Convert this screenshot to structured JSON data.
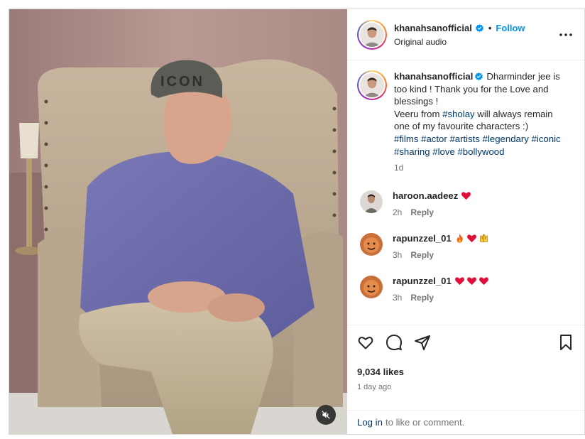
{
  "header": {
    "username": "khanahsanofficial",
    "separator": "•",
    "follow_label": "Follow",
    "audio": "Original audio"
  },
  "caption": {
    "username": "khanahsanofficial",
    "line1": "Dharminder jee is too kind ! Thank you for the Love and blessings !",
    "line2_prefix": "Veeru from ",
    "line2_tag": "#sholay",
    "line2_suffix": " will always remain one of my favourite characters :)",
    "tags": [
      "#films",
      "#actor",
      "#artists",
      "#legendary",
      "#iconic",
      "#sharing",
      "#love",
      "#bollywood"
    ],
    "time": "1d"
  },
  "comments": [
    {
      "username": "haroon.aadeez",
      "emojis": [
        "red-heart"
      ],
      "time": "2h",
      "reply_label": "Reply"
    },
    {
      "username": "rapunzzel_01",
      "emojis": [
        "fire",
        "red-heart",
        "raising-hands"
      ],
      "time": "3h",
      "reply_label": "Reply"
    },
    {
      "username": "rapunzzel_01",
      "emojis": [
        "red-heart",
        "red-heart",
        "red-heart"
      ],
      "time": "3h",
      "reply_label": "Reply"
    }
  ],
  "media": {
    "cap_text": "ICON",
    "mute_state": "muted"
  },
  "actions": {
    "icons": [
      "heart-icon",
      "comment-icon",
      "share-icon",
      "save-icon"
    ]
  },
  "likes": "9,034 likes",
  "posted": "1 day ago",
  "login": {
    "link": "Log in",
    "text": "to like or comment."
  },
  "colors": {
    "accent": "#0095f6",
    "hashtag": "#00376b",
    "heart": "#ff3040",
    "verified": "#0095f6"
  }
}
